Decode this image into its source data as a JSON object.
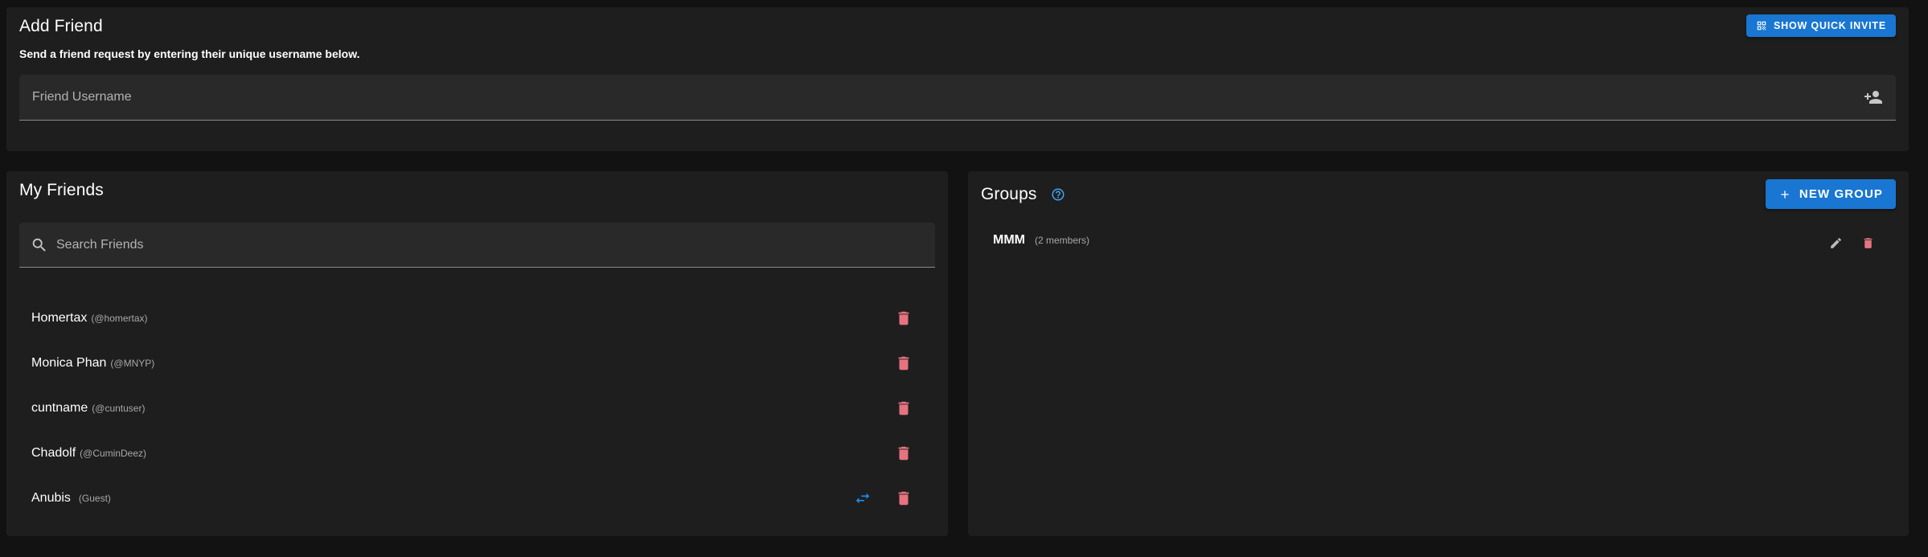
{
  "add_friend": {
    "title": "Add Friend",
    "subtitle": "Send a friend request by entering their unique username below.",
    "quick_invite_label": "Show Quick Invite",
    "username_placeholder": "Friend Username"
  },
  "my_friends": {
    "title": "My Friends",
    "search_placeholder": "Search Friends",
    "friends": [
      {
        "name": "Homertax",
        "handle": "(@homertax)",
        "guest": false
      },
      {
        "name": "Monica Phan",
        "handle": "(@MNYP)",
        "guest": false
      },
      {
        "name": "cuntname",
        "handle": "(@cuntuser)",
        "guest": false
      },
      {
        "name": "Chadolf",
        "handle": "(@CuminDeez)",
        "guest": false
      },
      {
        "name": "Anubis",
        "handle": "(Guest)",
        "guest": true
      }
    ]
  },
  "groups": {
    "title": "Groups",
    "new_group_label": "New Group",
    "items": [
      {
        "name": "MMM",
        "members": "(2 members)"
      }
    ]
  },
  "colors": {
    "background": "#121212",
    "card": "#1e1e1e",
    "accent": "#1976d2",
    "delete": "#e57380",
    "help": "#42a5f5"
  },
  "icons": {
    "quick_invite": "qr-code-icon",
    "add_friend": "person-add-icon",
    "search": "search-icon",
    "delete": "trash-icon",
    "convert": "swap-arrows-icon",
    "help": "help-circle-icon",
    "add": "plus-icon",
    "edit": "pencil-icon"
  }
}
